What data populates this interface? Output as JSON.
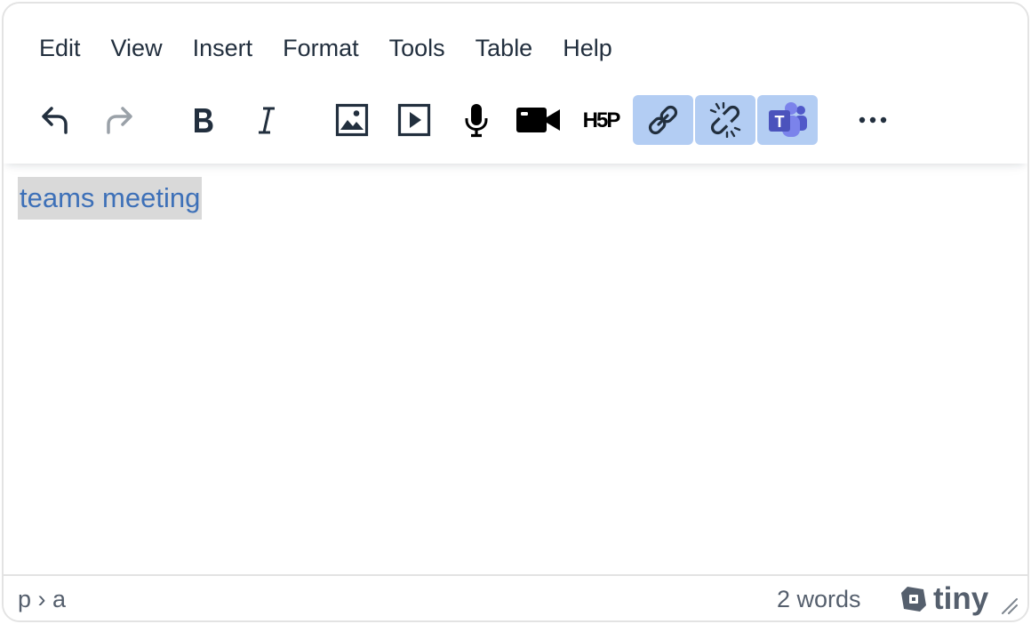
{
  "menubar": {
    "items": [
      "Edit",
      "View",
      "Insert",
      "Format",
      "Tools",
      "Table",
      "Help"
    ]
  },
  "toolbar": {
    "buttons": [
      {
        "icon": "undo-icon",
        "state": "enabled"
      },
      {
        "icon": "redo-icon",
        "state": "disabled"
      },
      {
        "icon": "bold-icon",
        "state": "enabled"
      },
      {
        "icon": "italic-icon",
        "state": "enabled"
      },
      {
        "icon": "image-icon",
        "state": "enabled"
      },
      {
        "icon": "media-icon",
        "state": "enabled"
      },
      {
        "icon": "microphone-icon",
        "state": "enabled"
      },
      {
        "icon": "video-camera-icon",
        "state": "enabled"
      },
      {
        "icon": "h5p-icon",
        "state": "enabled"
      },
      {
        "icon": "link-icon",
        "state": "active"
      },
      {
        "icon": "unlink-icon",
        "state": "active"
      },
      {
        "icon": "teams-icon",
        "state": "active"
      },
      {
        "icon": "more-icon",
        "state": "enabled"
      }
    ],
    "h5p_label": "H5P",
    "teams_letter": "T"
  },
  "content": {
    "link_text": "teams meeting"
  },
  "statusbar": {
    "path": "p › a",
    "word_count": "2 words",
    "brand": "tiny"
  },
  "colors": {
    "text": "#222f3e",
    "active_button_bg": "#b3cdf3",
    "link": "#3d70b8",
    "selection_bg": "#d9d9d9",
    "status_text": "#555f6d",
    "teams_purple": "#5059c9"
  }
}
